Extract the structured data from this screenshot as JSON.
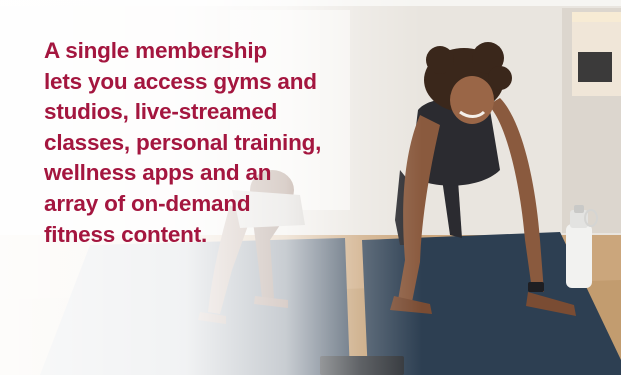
{
  "headline": {
    "lines": [
      "A single membership",
      "lets you access gyms and",
      "studios, live-streamed",
      "classes, personal training,",
      "wellness apps and an",
      "array of on-demand",
      "fitness content."
    ]
  },
  "colors": {
    "headline_text": "#A4163F",
    "wall": "#E9E5DF",
    "floor": "#CBA67C",
    "mat": "#2D3F52",
    "skin": "#8A5A3E",
    "outfit": "#2B2B30",
    "hair": "#3A271B",
    "bottle": "#F2F2F0"
  },
  "scene": {
    "subjects": [
      "woman-in-plank-pose",
      "child-in-plank-pose"
    ],
    "objects": [
      "yoga-mat-right",
      "yoga-mat-left",
      "water-bottle",
      "kitchen-doorway",
      "window"
    ]
  }
}
